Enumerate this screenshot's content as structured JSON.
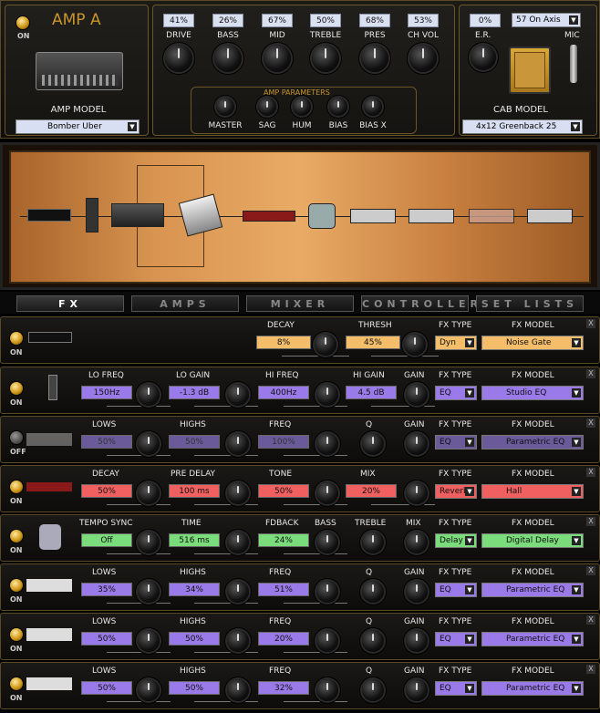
{
  "amp": {
    "power_label": "ON",
    "title": "AMP A",
    "amp_model_label": "AMP MODEL",
    "amp_model": "Bomber Uber",
    "knobs": [
      {
        "label": "DRIVE",
        "value": "41%"
      },
      {
        "label": "BASS",
        "value": "26%"
      },
      {
        "label": "MID",
        "value": "67%"
      },
      {
        "label": "TREBLE",
        "value": "50%"
      },
      {
        "label": "PRES",
        "value": "68%"
      },
      {
        "label": "CH VOL",
        "value": "53%"
      }
    ],
    "params_title": "AMP PARAMETERS",
    "params": [
      "MASTER",
      "SAG",
      "HUM",
      "BIAS",
      "BIAS X"
    ],
    "er_label": "E.R.",
    "er_value": "0%",
    "mic_position": "57 On Axis",
    "mic_label": "MIC",
    "cab_model_label": "CAB MODEL",
    "cab_model": "4x12 Greenback 25"
  },
  "tabs": [
    "FX",
    "AMPS",
    "MIXER",
    "CONTROLLERS",
    "SET LISTS"
  ],
  "fx_type_label": "FX TYPE",
  "fx_model_label": "FX MODEL",
  "close_glyph": "X",
  "rows": [
    {
      "power": "ON",
      "params": [
        {
          "label": "DECAY",
          "value": "8%"
        },
        {
          "label": "THRESH",
          "value": "45%"
        }
      ],
      "type": "Dyn",
      "model": "Noise Gate"
    },
    {
      "power": "ON",
      "params": [
        {
          "label": "LO FREQ",
          "value": "150Hz"
        },
        {
          "label": "LO GAIN",
          "value": "-1.3 dB"
        },
        {
          "label": "HI FREQ",
          "value": "400Hz"
        },
        {
          "label": "HI GAIN",
          "value": "4.5 dB"
        },
        {
          "label": "GAIN",
          "value": ""
        }
      ],
      "type": "EQ",
      "model": "Studio EQ"
    },
    {
      "power": "OFF",
      "params": [
        {
          "label": "LOWS",
          "value": "50%"
        },
        {
          "label": "HIGHS",
          "value": "50%"
        },
        {
          "label": "FREQ",
          "value": "100%"
        },
        {
          "label": "Q",
          "value": ""
        },
        {
          "label": "GAIN",
          "value": ""
        }
      ],
      "type": "EQ",
      "model": "Parametric EQ"
    },
    {
      "power": "ON",
      "params": [
        {
          "label": "DECAY",
          "value": "50%"
        },
        {
          "label": "PRE DELAY",
          "value": "100 ms"
        },
        {
          "label": "TONE",
          "value": "50%"
        },
        {
          "label": "MIX",
          "value": "20%"
        }
      ],
      "type": "Reverb",
      "model": "Hall"
    },
    {
      "power": "ON",
      "params": [
        {
          "label": "TEMPO SYNC",
          "value": "Off"
        },
        {
          "label": "TIME",
          "value": "516 ms"
        },
        {
          "label": "FDBACK",
          "value": "24%"
        },
        {
          "label": "BASS",
          "value": ""
        },
        {
          "label": "TREBLE",
          "value": ""
        },
        {
          "label": "MIX",
          "value": ""
        }
      ],
      "type": "Delay",
      "model": "Digital Delay"
    },
    {
      "power": "ON",
      "params": [
        {
          "label": "LOWS",
          "value": "35%"
        },
        {
          "label": "HIGHS",
          "value": "34%"
        },
        {
          "label": "FREQ",
          "value": "51%"
        },
        {
          "label": "Q",
          "value": ""
        },
        {
          "label": "GAIN",
          "value": ""
        }
      ],
      "type": "EQ",
      "model": "Parametric EQ"
    },
    {
      "power": "ON",
      "params": [
        {
          "label": "LOWS",
          "value": "50%"
        },
        {
          "label": "HIGHS",
          "value": "50%"
        },
        {
          "label": "FREQ",
          "value": "20%"
        },
        {
          "label": "Q",
          "value": ""
        },
        {
          "label": "GAIN",
          "value": ""
        }
      ],
      "type": "EQ",
      "model": "Parametric EQ"
    },
    {
      "power": "ON",
      "params": [
        {
          "label": "LOWS",
          "value": "50%"
        },
        {
          "label": "HIGHS",
          "value": "50%"
        },
        {
          "label": "FREQ",
          "value": "32%"
        },
        {
          "label": "Q",
          "value": ""
        },
        {
          "label": "GAIN",
          "value": ""
        }
      ],
      "type": "EQ",
      "model": "Parametric EQ"
    }
  ],
  "colors": {
    "gold": "#d09818",
    "orange": "#f4bd6a",
    "purple": "#9a7ae8",
    "red": "#f06060",
    "green": "#7adc7a"
  }
}
